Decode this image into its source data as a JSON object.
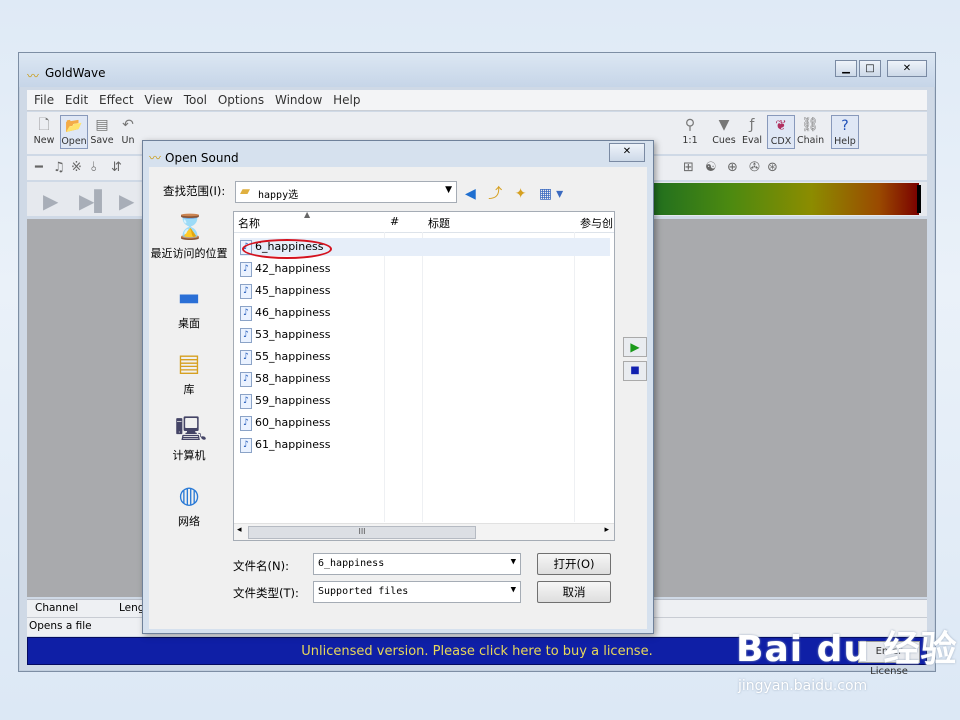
{
  "app": {
    "title": "GoldWave",
    "menu": [
      "File",
      "Edit",
      "Effect",
      "View",
      "Tool",
      "Options",
      "Window",
      "Help"
    ],
    "toolbar": [
      {
        "label": "New",
        "icon": "new-file-icon"
      },
      {
        "label": "Open",
        "icon": "open-file-icon"
      },
      {
        "label": "Save",
        "icon": "save-icon"
      },
      {
        "label": "Un",
        "icon": "undo-icon"
      },
      {
        "label": "1:1",
        "icon": "zoom-1-1-icon"
      },
      {
        "label": "Cues",
        "icon": "cues-icon"
      },
      {
        "label": "Eval",
        "icon": "eval-icon"
      },
      {
        "label": "CDX",
        "icon": "cdx-icon"
      },
      {
        "label": "Chain",
        "icon": "chain-icon"
      },
      {
        "label": "Help",
        "icon": "help-icon"
      }
    ],
    "status": {
      "channel": "Channel",
      "length": "Lengt",
      "hint": "Opens a file"
    },
    "license": {
      "message": "Unlicensed version. Please click here to buy a license.",
      "button": "Enter License"
    }
  },
  "dialog": {
    "title": "Open Sound",
    "look_in_label": "查找范围(I):",
    "look_in_value": "happy选",
    "places": [
      "最近访问的位置",
      "桌面",
      "库",
      "计算机",
      "网络"
    ],
    "columns": [
      "名称",
      "#",
      "标题",
      "参与创"
    ],
    "files": [
      "6_happiness",
      "42_happiness",
      "45_happiness",
      "46_happiness",
      "53_happiness",
      "55_happiness",
      "58_happiness",
      "59_happiness",
      "60_happiness",
      "61_happiness"
    ],
    "filename_label": "文件名(N):",
    "filename_value": "6_happiness",
    "filetype_label": "文件类型(T):",
    "filetype_value": "Supported files",
    "open_button": "打开(O)",
    "cancel_button": "取消"
  },
  "watermark": {
    "brand": "Bai du 经验",
    "url": "jingyan.baidu.com"
  }
}
